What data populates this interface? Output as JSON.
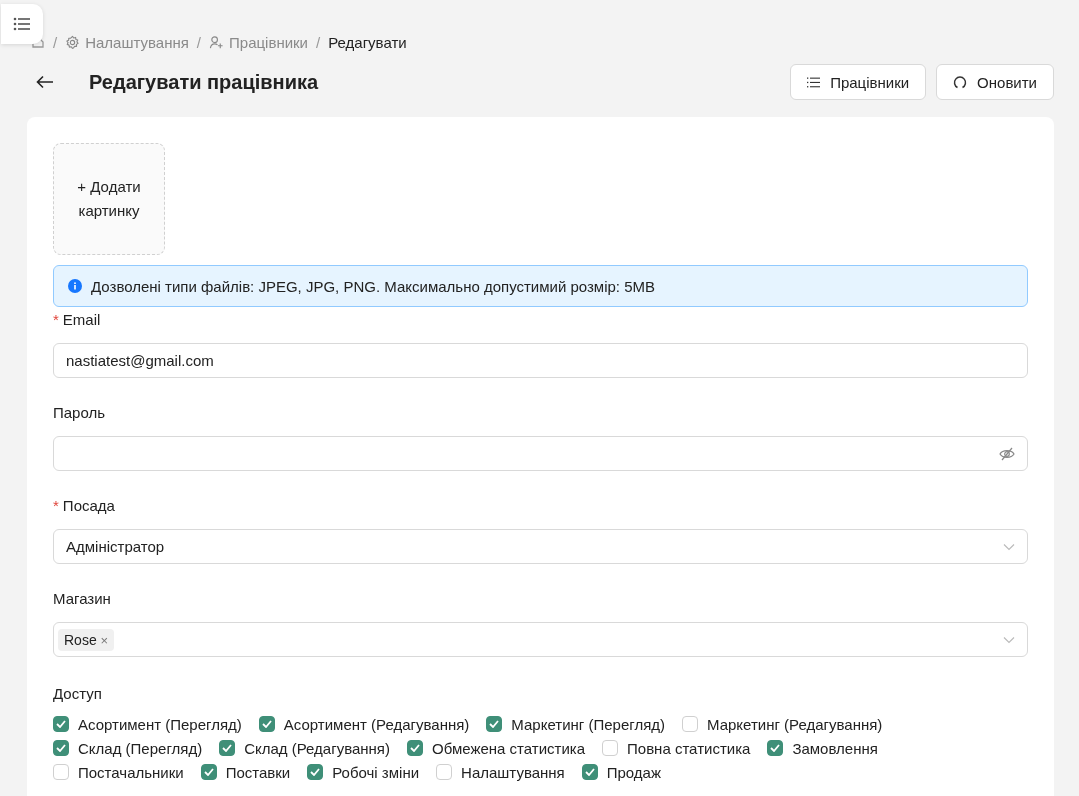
{
  "breadcrumb": [
    {
      "separator": "/",
      "label": "Налаштування"
    },
    {
      "separator": "/",
      "label": "Працівники"
    },
    {
      "separator": "/",
      "label": "Редагувати"
    }
  ],
  "title": "Редагувати працівника",
  "header_buttons": [
    {
      "label": "Працівники"
    },
    {
      "label": "Оновити"
    }
  ],
  "upload": {
    "label": "+ Додати картинку"
  },
  "info": "Дозволені типи файлів: JPEG, JPG, PNG. Максимально допустимий розмір: 5MB",
  "required_mark": "*",
  "fields": [
    {
      "kind": "text",
      "label": "Email",
      "required": true,
      "value": "nastiatest@gmail.com"
    },
    {
      "kind": "password",
      "label": "Пароль",
      "required": false
    },
    {
      "kind": "select",
      "label": "Посада",
      "required": true,
      "value": "Адміністратор"
    },
    {
      "kind": "tags",
      "label": "Магазин",
      "required": false,
      "tags": [
        "Rose"
      ],
      "remove": "×"
    }
  ],
  "access": {
    "label": "Доступ",
    "items": [
      {
        "label": "Асортимент (Перегляд)",
        "checked": true
      },
      {
        "label": "Асортимент (Редагування)",
        "checked": true
      },
      {
        "label": "Маркетинг (Перегляд)",
        "checked": true
      },
      {
        "label": "Маркетинг (Редагування)",
        "checked": false
      },
      {
        "label": "Склад (Перегляд)",
        "checked": true
      },
      {
        "label": "Склад (Редагування)",
        "checked": true
      },
      {
        "label": "Обмежена статистика",
        "checked": true
      },
      {
        "label": "Повна статистика",
        "checked": false
      },
      {
        "label": "Замовлення",
        "checked": true
      },
      {
        "label": "Постачальники",
        "checked": false
      },
      {
        "label": "Поставки",
        "checked": true
      },
      {
        "label": "Робочі зміни",
        "checked": true
      },
      {
        "label": "Налаштування",
        "checked": false
      },
      {
        "label": "Продаж",
        "checked": true
      }
    ]
  }
}
